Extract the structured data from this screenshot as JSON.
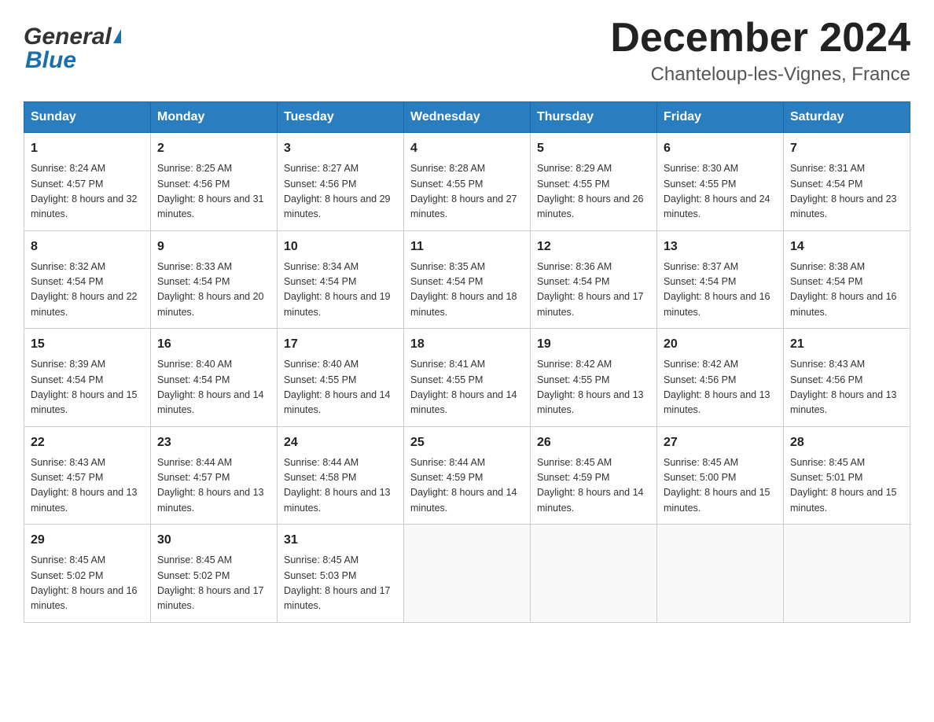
{
  "header": {
    "logo_general": "General",
    "logo_blue": "Blue",
    "month_title": "December 2024",
    "location": "Chanteloup-les-Vignes, France"
  },
  "calendar": {
    "days_of_week": [
      "Sunday",
      "Monday",
      "Tuesday",
      "Wednesday",
      "Thursday",
      "Friday",
      "Saturday"
    ],
    "weeks": [
      [
        {
          "day": "1",
          "sunrise": "Sunrise: 8:24 AM",
          "sunset": "Sunset: 4:57 PM",
          "daylight": "Daylight: 8 hours and 32 minutes."
        },
        {
          "day": "2",
          "sunrise": "Sunrise: 8:25 AM",
          "sunset": "Sunset: 4:56 PM",
          "daylight": "Daylight: 8 hours and 31 minutes."
        },
        {
          "day": "3",
          "sunrise": "Sunrise: 8:27 AM",
          "sunset": "Sunset: 4:56 PM",
          "daylight": "Daylight: 8 hours and 29 minutes."
        },
        {
          "day": "4",
          "sunrise": "Sunrise: 8:28 AM",
          "sunset": "Sunset: 4:55 PM",
          "daylight": "Daylight: 8 hours and 27 minutes."
        },
        {
          "day": "5",
          "sunrise": "Sunrise: 8:29 AM",
          "sunset": "Sunset: 4:55 PM",
          "daylight": "Daylight: 8 hours and 26 minutes."
        },
        {
          "day": "6",
          "sunrise": "Sunrise: 8:30 AM",
          "sunset": "Sunset: 4:55 PM",
          "daylight": "Daylight: 8 hours and 24 minutes."
        },
        {
          "day": "7",
          "sunrise": "Sunrise: 8:31 AM",
          "sunset": "Sunset: 4:54 PM",
          "daylight": "Daylight: 8 hours and 23 minutes."
        }
      ],
      [
        {
          "day": "8",
          "sunrise": "Sunrise: 8:32 AM",
          "sunset": "Sunset: 4:54 PM",
          "daylight": "Daylight: 8 hours and 22 minutes."
        },
        {
          "day": "9",
          "sunrise": "Sunrise: 8:33 AM",
          "sunset": "Sunset: 4:54 PM",
          "daylight": "Daylight: 8 hours and 20 minutes."
        },
        {
          "day": "10",
          "sunrise": "Sunrise: 8:34 AM",
          "sunset": "Sunset: 4:54 PM",
          "daylight": "Daylight: 8 hours and 19 minutes."
        },
        {
          "day": "11",
          "sunrise": "Sunrise: 8:35 AM",
          "sunset": "Sunset: 4:54 PM",
          "daylight": "Daylight: 8 hours and 18 minutes."
        },
        {
          "day": "12",
          "sunrise": "Sunrise: 8:36 AM",
          "sunset": "Sunset: 4:54 PM",
          "daylight": "Daylight: 8 hours and 17 minutes."
        },
        {
          "day": "13",
          "sunrise": "Sunrise: 8:37 AM",
          "sunset": "Sunset: 4:54 PM",
          "daylight": "Daylight: 8 hours and 16 minutes."
        },
        {
          "day": "14",
          "sunrise": "Sunrise: 8:38 AM",
          "sunset": "Sunset: 4:54 PM",
          "daylight": "Daylight: 8 hours and 16 minutes."
        }
      ],
      [
        {
          "day": "15",
          "sunrise": "Sunrise: 8:39 AM",
          "sunset": "Sunset: 4:54 PM",
          "daylight": "Daylight: 8 hours and 15 minutes."
        },
        {
          "day": "16",
          "sunrise": "Sunrise: 8:40 AM",
          "sunset": "Sunset: 4:54 PM",
          "daylight": "Daylight: 8 hours and 14 minutes."
        },
        {
          "day": "17",
          "sunrise": "Sunrise: 8:40 AM",
          "sunset": "Sunset: 4:55 PM",
          "daylight": "Daylight: 8 hours and 14 minutes."
        },
        {
          "day": "18",
          "sunrise": "Sunrise: 8:41 AM",
          "sunset": "Sunset: 4:55 PM",
          "daylight": "Daylight: 8 hours and 14 minutes."
        },
        {
          "day": "19",
          "sunrise": "Sunrise: 8:42 AM",
          "sunset": "Sunset: 4:55 PM",
          "daylight": "Daylight: 8 hours and 13 minutes."
        },
        {
          "day": "20",
          "sunrise": "Sunrise: 8:42 AM",
          "sunset": "Sunset: 4:56 PM",
          "daylight": "Daylight: 8 hours and 13 minutes."
        },
        {
          "day": "21",
          "sunrise": "Sunrise: 8:43 AM",
          "sunset": "Sunset: 4:56 PM",
          "daylight": "Daylight: 8 hours and 13 minutes."
        }
      ],
      [
        {
          "day": "22",
          "sunrise": "Sunrise: 8:43 AM",
          "sunset": "Sunset: 4:57 PM",
          "daylight": "Daylight: 8 hours and 13 minutes."
        },
        {
          "day": "23",
          "sunrise": "Sunrise: 8:44 AM",
          "sunset": "Sunset: 4:57 PM",
          "daylight": "Daylight: 8 hours and 13 minutes."
        },
        {
          "day": "24",
          "sunrise": "Sunrise: 8:44 AM",
          "sunset": "Sunset: 4:58 PM",
          "daylight": "Daylight: 8 hours and 13 minutes."
        },
        {
          "day": "25",
          "sunrise": "Sunrise: 8:44 AM",
          "sunset": "Sunset: 4:59 PM",
          "daylight": "Daylight: 8 hours and 14 minutes."
        },
        {
          "day": "26",
          "sunrise": "Sunrise: 8:45 AM",
          "sunset": "Sunset: 4:59 PM",
          "daylight": "Daylight: 8 hours and 14 minutes."
        },
        {
          "day": "27",
          "sunrise": "Sunrise: 8:45 AM",
          "sunset": "Sunset: 5:00 PM",
          "daylight": "Daylight: 8 hours and 15 minutes."
        },
        {
          "day": "28",
          "sunrise": "Sunrise: 8:45 AM",
          "sunset": "Sunset: 5:01 PM",
          "daylight": "Daylight: 8 hours and 15 minutes."
        }
      ],
      [
        {
          "day": "29",
          "sunrise": "Sunrise: 8:45 AM",
          "sunset": "Sunset: 5:02 PM",
          "daylight": "Daylight: 8 hours and 16 minutes."
        },
        {
          "day": "30",
          "sunrise": "Sunrise: 8:45 AM",
          "sunset": "Sunset: 5:02 PM",
          "daylight": "Daylight: 8 hours and 17 minutes."
        },
        {
          "day": "31",
          "sunrise": "Sunrise: 8:45 AM",
          "sunset": "Sunset: 5:03 PM",
          "daylight": "Daylight: 8 hours and 17 minutes."
        },
        null,
        null,
        null,
        null
      ]
    ]
  }
}
